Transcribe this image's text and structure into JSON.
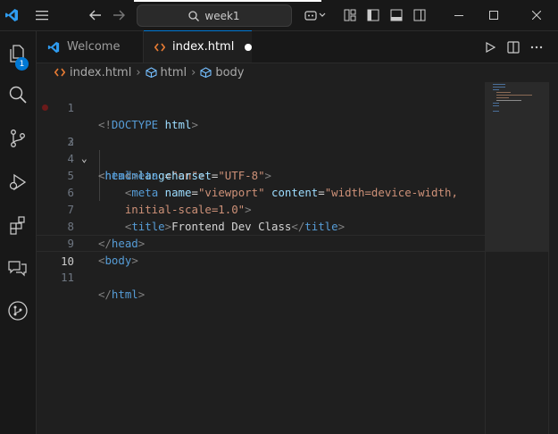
{
  "titlebar": {
    "search_text": "week1",
    "icons": [
      "vscode-logo-icon",
      "menu-icon",
      "back-arrow-icon",
      "forward-arrow-icon",
      "search-icon",
      "copilot-icon",
      "layout-icon",
      "toggle-sidebar-icon",
      "toggle-panel-icon",
      "toggle-secondary-sidebar-icon",
      "minimize-icon",
      "maximize-icon",
      "close-icon"
    ]
  },
  "activity": {
    "explorer_badge": "1",
    "icons": [
      "explorer-icon",
      "search-icon",
      "source-control-icon",
      "run-debug-icon",
      "extensions-icon",
      "chat-icon",
      "git-graph-icon"
    ]
  },
  "tabs": [
    {
      "label": "Welcome",
      "icon": "vscode-logo-icon",
      "active": false
    },
    {
      "label": "index.html",
      "icon": "html-file-icon",
      "active": true,
      "modified": true
    }
  ],
  "breadcrumbs": [
    "index.html",
    "html",
    "body"
  ],
  "editor": {
    "current_line": 10,
    "lines": [
      {
        "n": "1",
        "text": "<!DOCTYPE html>"
      },
      {
        "n": "2",
        "text": "<html lang=\"en\">"
      },
      {
        "n": "3",
        "text": "<head>"
      },
      {
        "n": "4",
        "text": "    <meta charset=\"UTF-8\">"
      },
      {
        "n": "5",
        "text": "    <meta name=\"viewport\" content=\"width=device-width,"
      },
      {
        "n": "6",
        "text": "    initial-scale=1.0\">"
      },
      {
        "n": "7",
        "text": "    <title>Frontend Dev Class</title>"
      },
      {
        "n": "8",
        "text": "</head>"
      },
      {
        "n": "9",
        "text": "<body>"
      },
      {
        "n": "10",
        "text": ""
      },
      {
        "n": "11",
        "text": "</html>"
      }
    ]
  },
  "colors": {
    "accent": "#0078d4",
    "tag": "#569cd6",
    "attribute": "#9cdcfe",
    "string": "#ce9178",
    "text": "#d4d4d4",
    "breakpoint": "#6b1a1a"
  }
}
